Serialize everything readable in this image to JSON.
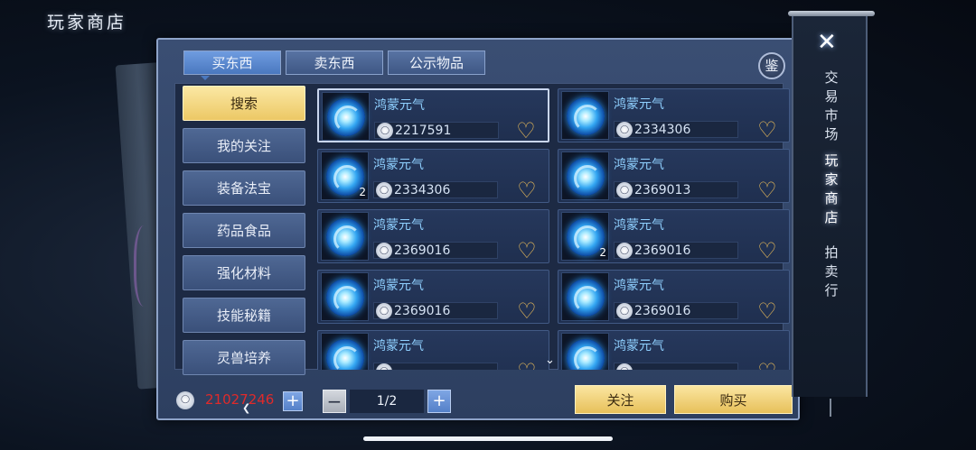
{
  "header": {
    "title": "玩家商店"
  },
  "tabs": [
    {
      "label": "买东西",
      "active": true
    },
    {
      "label": "卖东西",
      "active": false
    },
    {
      "label": "公示物品",
      "active": false
    }
  ],
  "appraise_button": "鉴",
  "sidebar": {
    "items": [
      {
        "label": "搜索",
        "active": true
      },
      {
        "label": "我的关注",
        "active": false
      },
      {
        "label": "装备法宝",
        "active": false
      },
      {
        "label": "药品食品",
        "active": false
      },
      {
        "label": "强化材料",
        "active": false
      },
      {
        "label": "技能秘籍",
        "active": false
      },
      {
        "label": "灵兽培养",
        "active": false
      }
    ],
    "scroll_icon": "chevron-down-icon"
  },
  "listings": [
    {
      "name": "鸿蒙元气",
      "price": "2217591",
      "qty": "",
      "selected": true
    },
    {
      "name": "鸿蒙元气",
      "price": "2334306",
      "qty": ""
    },
    {
      "name": "鸿蒙元气",
      "price": "2334306",
      "qty": "2"
    },
    {
      "name": "鸿蒙元气",
      "price": "2369013",
      "qty": ""
    },
    {
      "name": "鸿蒙元气",
      "price": "2369016",
      "qty": ""
    },
    {
      "name": "鸿蒙元气",
      "price": "2369016",
      "qty": "2"
    },
    {
      "name": "鸿蒙元气",
      "price": "2369016",
      "qty": ""
    },
    {
      "name": "鸿蒙元气",
      "price": "2369016",
      "qty": ""
    },
    {
      "name": "鸿蒙元气",
      "price": "",
      "qty": ""
    },
    {
      "name": "鸿蒙元气",
      "price": "",
      "qty": ""
    }
  ],
  "footer": {
    "balance": "21027246",
    "page": "1/2",
    "follow_label": "关注",
    "buy_label": "购买"
  },
  "side_scroll": {
    "close_icon": "close-icon",
    "menu": [
      {
        "label": "交易市场",
        "current": false
      },
      {
        "label": "玩家商店",
        "current": true
      },
      {
        "label": "拍卖行",
        "current": false
      }
    ]
  },
  "colors": {
    "accent_gold": "#ecc865",
    "balance_red": "#e02a2a",
    "item_name_blue": "#8fd0ff"
  }
}
